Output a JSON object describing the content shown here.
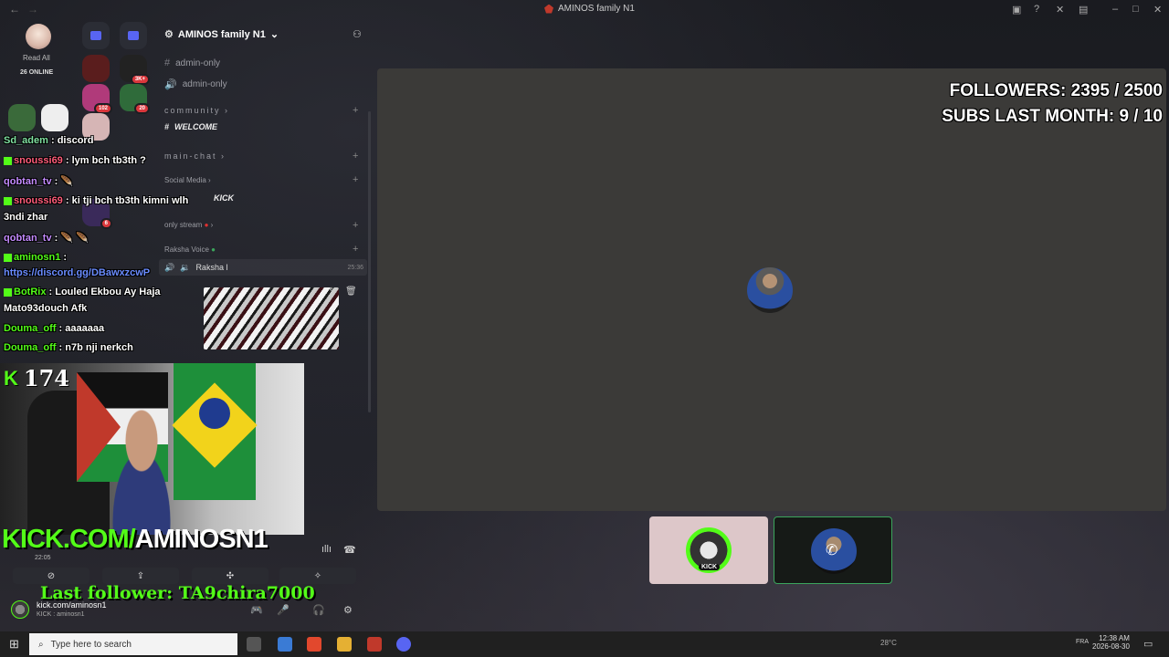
{
  "window": {
    "title": "AMINOS family N1",
    "back": "←",
    "forward": "→"
  },
  "servers": {
    "read_all": "Read All",
    "online": "26 ONLINE",
    "badges": [
      "3K+",
      "102",
      "20",
      "6"
    ]
  },
  "server_header": {
    "name": "AMINOS family N1"
  },
  "channels": {
    "admin1": "admin-only",
    "admin2": "admin-only",
    "cat_community": "community",
    "welcome": "WELCOME",
    "cat_main_chat": "main-chat",
    "cat_social": "Social Media",
    "kick_channel": "KICK",
    "cat_only_stream": "only stream",
    "cat_voice": "Raksha Voice",
    "voice_channel": "Raksha l",
    "voice_time": "25:36"
  },
  "chat": {
    "messages": [
      {
        "user": "Sd_adem",
        "text": ": discord",
        "color": "#7fe0a0"
      },
      {
        "user": "snoussi69",
        "text": ": lym bch tb3th ?",
        "color": "#ff5c7a"
      },
      {
        "user": "qobtan_tv",
        "text": ":",
        "color": "#c48bff"
      },
      {
        "user": "snoussi69",
        "text": ": ki tji bch tb3th kimni wlh",
        "color": "#ff5c7a"
      },
      {
        "user": "",
        "text": "3ndi zhar",
        "color": "#fff"
      },
      {
        "user": "qobtan_tv",
        "text": ":",
        "color": "#c48bff"
      },
      {
        "user": "aminosn1",
        "text": ":",
        "color": "#53fc18"
      },
      {
        "user": "",
        "text": "https://discord.gg/DBawxzcwP",
        "color": "#6a8cff"
      },
      {
        "user": "BotRix",
        "text": ": Louled Ekbou Ay Haja",
        "color": "#53fc18"
      },
      {
        "user": "",
        "text": "Mato93douch Afk",
        "color": "#fff"
      },
      {
        "user": "Douma_off",
        "text": ": aaaaaaa",
        "color": "#53fc18"
      },
      {
        "user": "Douma_off",
        "text": ": n7b nji nerkch",
        "color": "#53fc18"
      }
    ]
  },
  "overlay": {
    "viewer_count": "174",
    "kick_url_green": "KICK.COM/",
    "kick_url_white": "AMINOSN1",
    "last_follower": "Last follower: TA9chira7000",
    "followers_goal": "FOLLOWERS: 2395 / 2500",
    "subs_goal": "SUBS LAST MONTH: 9 / 10"
  },
  "voice_panel": {
    "elapsed": "22:05",
    "user_name": "kick.com/aminosn1",
    "user_status": "KICK : aminosn1"
  },
  "tiles": {
    "kick_label": "KICK"
  },
  "taskbar": {
    "search_placeholder": "Type here to search",
    "weather": "28°C",
    "time": "12:38 AM",
    "date": "2026-08-30",
    "lang": "FRA"
  },
  "colors": {
    "kick_green": "#53fc18",
    "discord_blurple": "#5865f2",
    "stream_bg": "#3b3a38"
  }
}
